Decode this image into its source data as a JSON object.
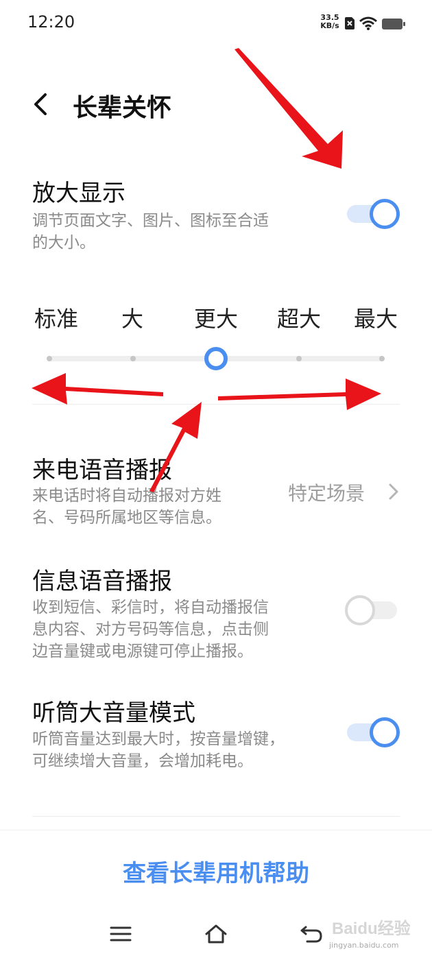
{
  "status_bar": {
    "time": "12:20",
    "net_speed_value": "33.5",
    "net_speed_unit": "KB/s"
  },
  "header": {
    "title": "长辈关怀",
    "back_icon": "chevron-left-icon"
  },
  "settings": {
    "zoom": {
      "title": "放大显示",
      "desc_line1": "调节页面文字、图片、图标至合适",
      "desc_line2": "的大小。",
      "enabled": true
    },
    "size_selector": {
      "options": [
        "标准",
        "大",
        "更大",
        "超大",
        "最大"
      ],
      "selected": "更大",
      "selected_index": 2
    },
    "incoming_call": {
      "title": "来电语音播报",
      "desc_line1": "来电话时将自动播报对方姓",
      "desc_line2": "名、号码所属地区等信息。",
      "value": "特定场景"
    },
    "message": {
      "title": "信息语音播报",
      "desc_line1": "收到短信、彩信时，将自动播报信",
      "desc_line2": "息内容、对方号码等信息，点击侧",
      "desc_line3": "边音量键或电源键可停止播报。",
      "enabled": false
    },
    "earpiece": {
      "title": "听筒大音量模式",
      "desc_line1": "听筒音量达到最大时，按音量增键，",
      "desc_line2": "可继续增大音量，会增加耗电。",
      "enabled": true
    }
  },
  "help_link": "查看长辈用机帮助",
  "nav_bar": {
    "icons": [
      "menu-icon",
      "home-icon",
      "back-icon"
    ]
  },
  "watermark": {
    "text": "Baidu经验",
    "url_text": "jingyan.baidu.com"
  },
  "colors": {
    "accent": "#4a8ef0",
    "annotation_arrow": "#e8141a"
  }
}
